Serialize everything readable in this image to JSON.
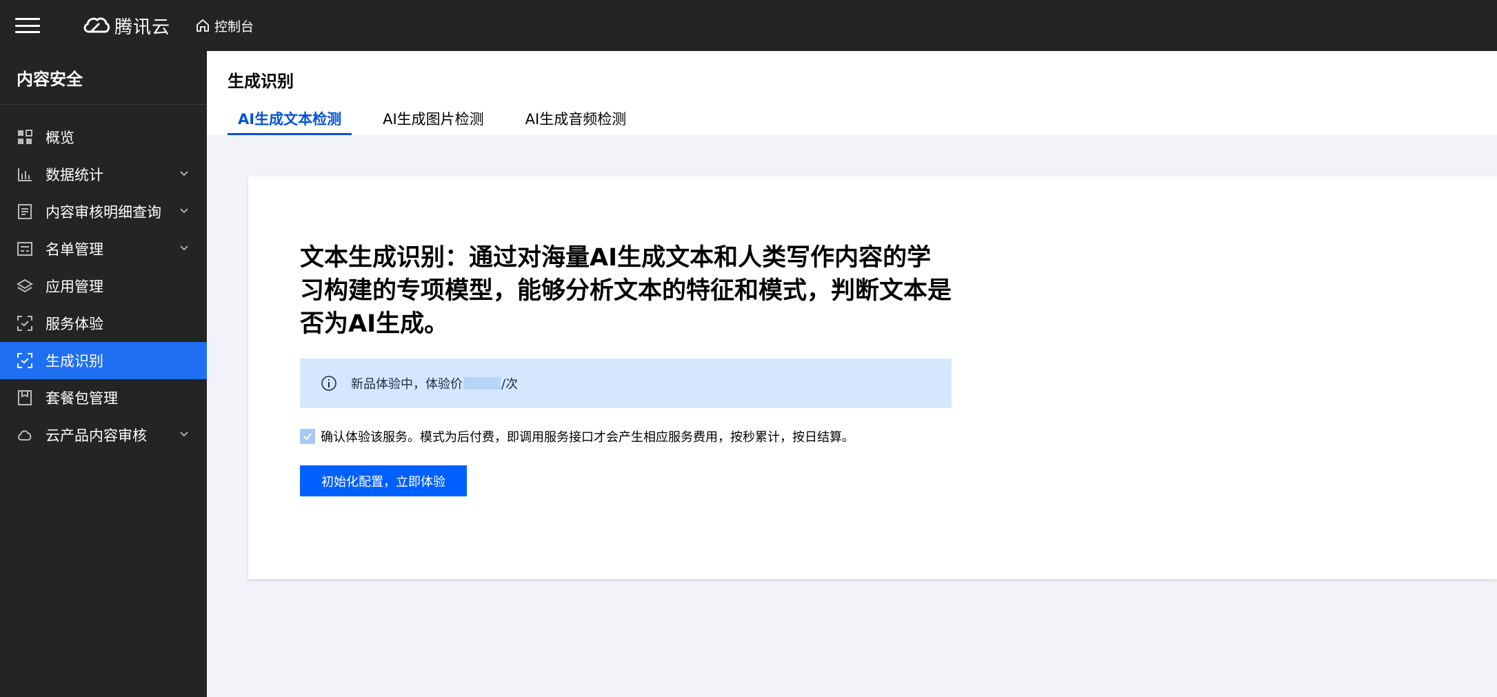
{
  "topbar": {
    "brand": "腾讯云",
    "console": "控制台"
  },
  "sidebar": {
    "title": "内容安全",
    "items": [
      {
        "label": "概览",
        "icon": "grid-icon",
        "expandable": false
      },
      {
        "label": "数据统计",
        "icon": "bar-chart-icon",
        "expandable": true
      },
      {
        "label": "内容审核明细查询",
        "icon": "document-list-icon",
        "expandable": true
      },
      {
        "label": "名单管理",
        "icon": "list-box-icon",
        "expandable": true
      },
      {
        "label": "应用管理",
        "icon": "layers-icon",
        "expandable": false
      },
      {
        "label": "服务体验",
        "icon": "scan-icon",
        "expandable": false
      },
      {
        "label": "生成识别",
        "icon": "scan-check-icon",
        "expandable": false,
        "active": true
      },
      {
        "label": "套餐包管理",
        "icon": "package-icon",
        "expandable": false
      },
      {
        "label": "云产品内容审核",
        "icon": "cloud-icon",
        "expandable": true
      }
    ]
  },
  "main": {
    "title": "生成识别",
    "tabs": [
      {
        "label": "AI生成文本检测",
        "active": true
      },
      {
        "label": "AI生成图片检测",
        "active": false
      },
      {
        "label": "AI生成音频检测",
        "active": false
      }
    ],
    "card": {
      "headline": "文本生成识别：通过对海量AI生成文本和人类写作内容的学习构建的专项模型，能够分析文本的特征和模式，判断文本是否为AI生成。",
      "notice_prefix": "新品体验中，体验价",
      "notice_suffix": "/次",
      "confirm_text": "确认体验该服务。模式为后付费，即调用服务接口才会产生相应服务费用，按秒累计，按日结算。",
      "confirm_checked": true,
      "button_label": "初始化配置，立即体验"
    }
  },
  "colors": {
    "dark_bg": "#242424",
    "active_nav": "#1f6ff2",
    "accent": "#0052d9",
    "button": "#0060ff",
    "notice_bg": "#d5e7ff"
  }
}
